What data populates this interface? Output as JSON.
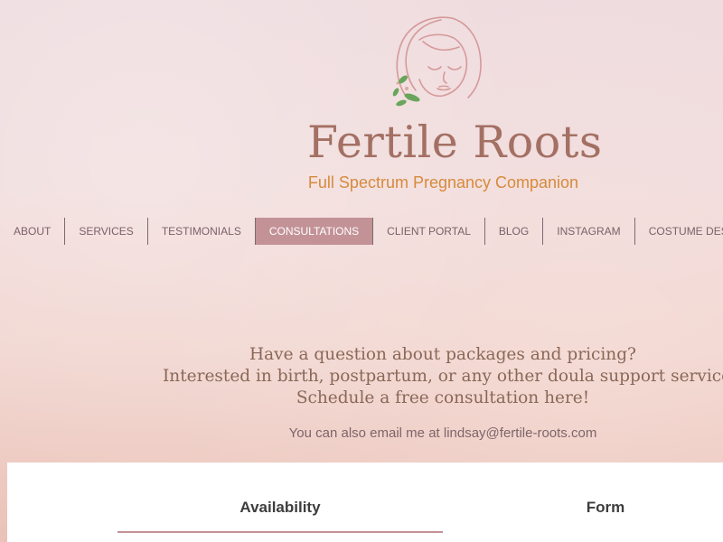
{
  "brand": {
    "name": "Fertile Roots",
    "tagline": "Full Spectrum Pregnancy Companion",
    "logo_icon": "woman-face-with-leaves-icon",
    "colors": {
      "title": "#a37063",
      "tagline": "#d68a3c",
      "accent": "#c39297"
    }
  },
  "nav": {
    "items": [
      {
        "label": "ABOUT",
        "active": false
      },
      {
        "label": "SERVICES",
        "active": false
      },
      {
        "label": "TESTIMONIALS",
        "active": false
      },
      {
        "label": "CONSULTATIONS",
        "active": true
      },
      {
        "label": "CLIENT PORTAL",
        "active": false
      },
      {
        "label": "BLOG",
        "active": false
      },
      {
        "label": "INSTAGRAM",
        "active": false
      },
      {
        "label": "COSTUME DESIG",
        "active": false
      }
    ]
  },
  "intro": {
    "line1": "Have a question about packages and pricing?",
    "line2": "Interested in birth, postpartum, or any other doula support services?",
    "line3": "Schedule a free consultation here!"
  },
  "contact": {
    "email_text": "You can also email me at lindsay@fertile-roots.com"
  },
  "booking": {
    "tabs": [
      {
        "label": "Availability",
        "active": true
      },
      {
        "label": "Form",
        "active": false
      }
    ]
  }
}
